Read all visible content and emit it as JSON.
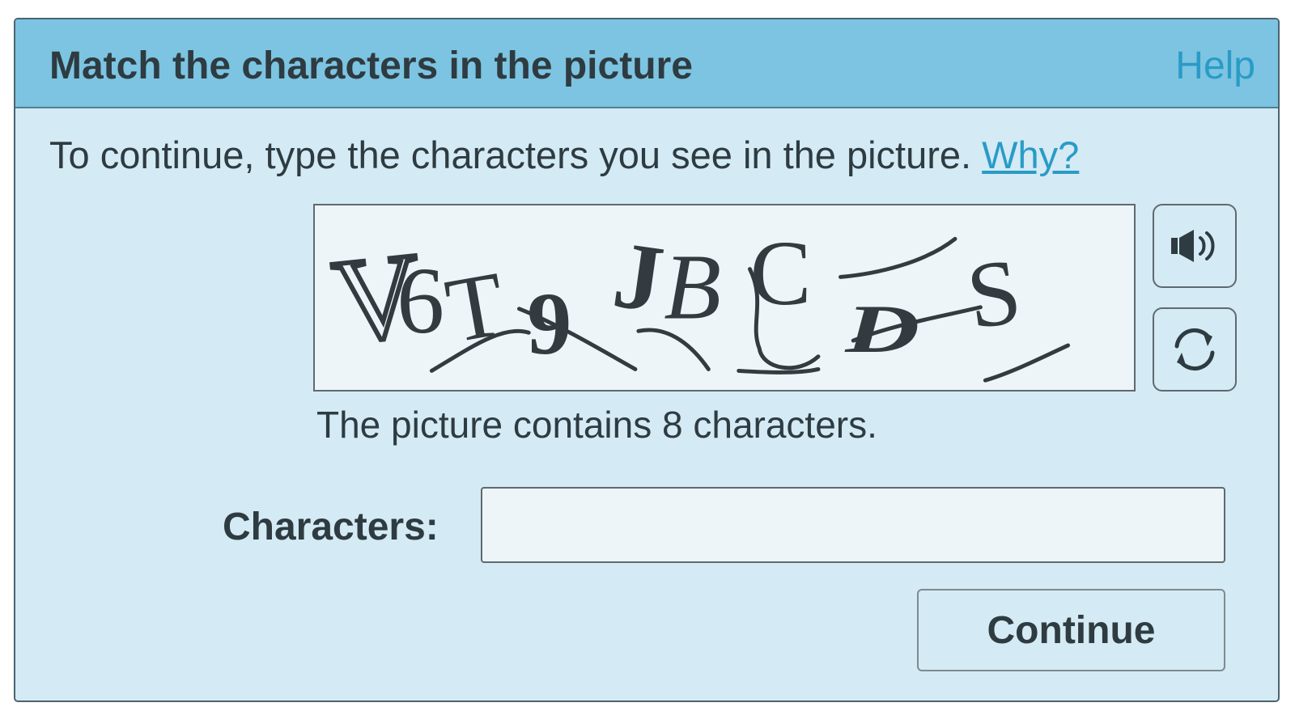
{
  "dialog": {
    "title": "Match the characters in the picture",
    "help_label": "Help",
    "instructions": "To continue, type the characters you see in the picture.",
    "why_label": "Why?",
    "hint": "The picture contains 8 characters.",
    "field_label": "Characters:",
    "input_value": "",
    "continue_label": "Continue"
  },
  "captcha": {
    "glyphs": [
      "V",
      "6",
      "T",
      "9",
      "J",
      "B",
      "C",
      "D",
      "S"
    ]
  },
  "icons": {
    "audio": "speaker-icon",
    "refresh": "refresh-icon"
  },
  "colors": {
    "header": "#7cc4e1",
    "body": "#d4eaf4",
    "link": "#2a9bc7",
    "text": "#2e3b41"
  }
}
